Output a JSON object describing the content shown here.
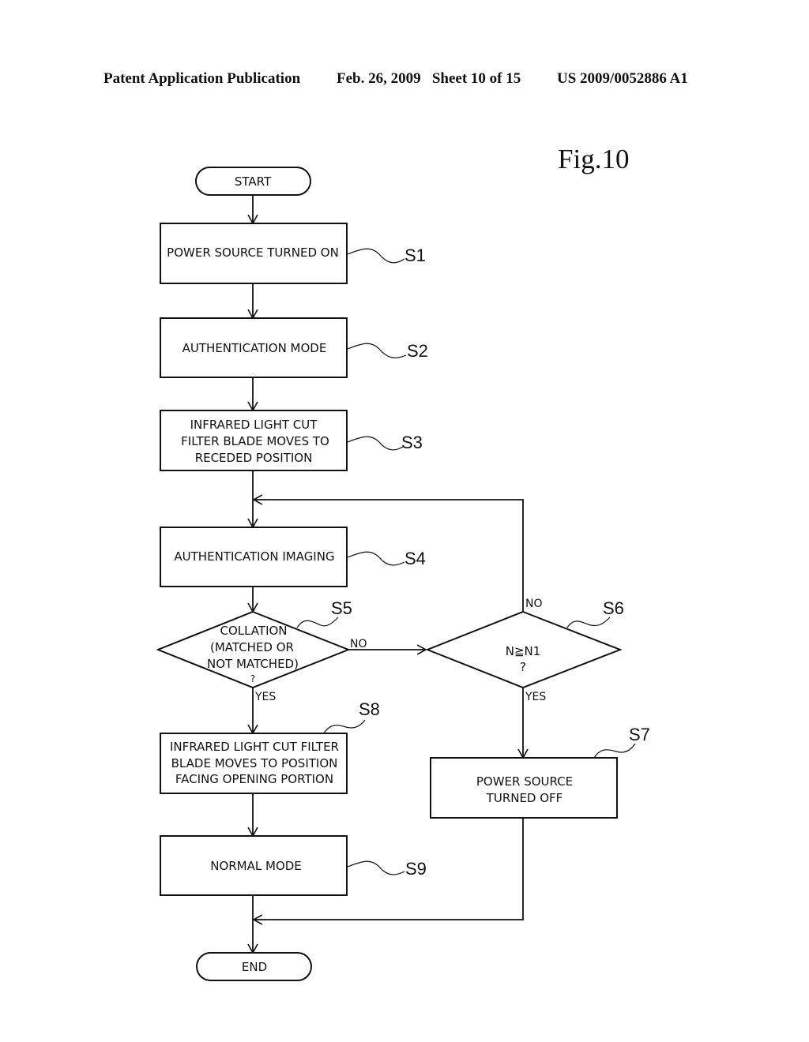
{
  "header": {
    "publication": "Patent Application Publication",
    "date_sheet": "Feb. 26, 2009   Sheet 10 of 15",
    "number": "US 2009/0052886 A1"
  },
  "figure": {
    "label": "Fig.10"
  },
  "flowchart": {
    "start": "START",
    "end": "END",
    "steps": {
      "s1": {
        "id": "S1",
        "lines": [
          "POWER SOURCE TURNED ON"
        ]
      },
      "s2": {
        "id": "S2",
        "lines": [
          "AUTHENTICATION MODE"
        ]
      },
      "s3": {
        "id": "S3",
        "lines": [
          "INFRARED LIGHT CUT",
          "FILTER BLADE MOVES TO",
          "RECEDED POSITION"
        ]
      },
      "s4": {
        "id": "S4",
        "lines": [
          "AUTHENTICATION IMAGING"
        ]
      },
      "s5": {
        "id": "S5",
        "lines": [
          "COLLATION",
          "(MATCHED OR",
          "NOT MATCHED)",
          "?"
        ]
      },
      "s6": {
        "id": "S6",
        "lines": [
          "N≧N1",
          "?"
        ]
      },
      "s7": {
        "id": "S7",
        "lines": [
          "POWER SOURCE",
          "TURNED OFF"
        ]
      },
      "s8": {
        "id": "S8",
        "lines": [
          "INFRARED LIGHT CUT FILTER",
          "BLADE MOVES TO POSITION",
          "FACING OPENING PORTION"
        ]
      },
      "s9": {
        "id": "S9",
        "lines": [
          "NORMAL MODE"
        ]
      }
    },
    "branch_labels": {
      "s5_no": "NO",
      "s5_yes": "YES",
      "s6_no": "NO",
      "s6_yes": "YES"
    }
  }
}
